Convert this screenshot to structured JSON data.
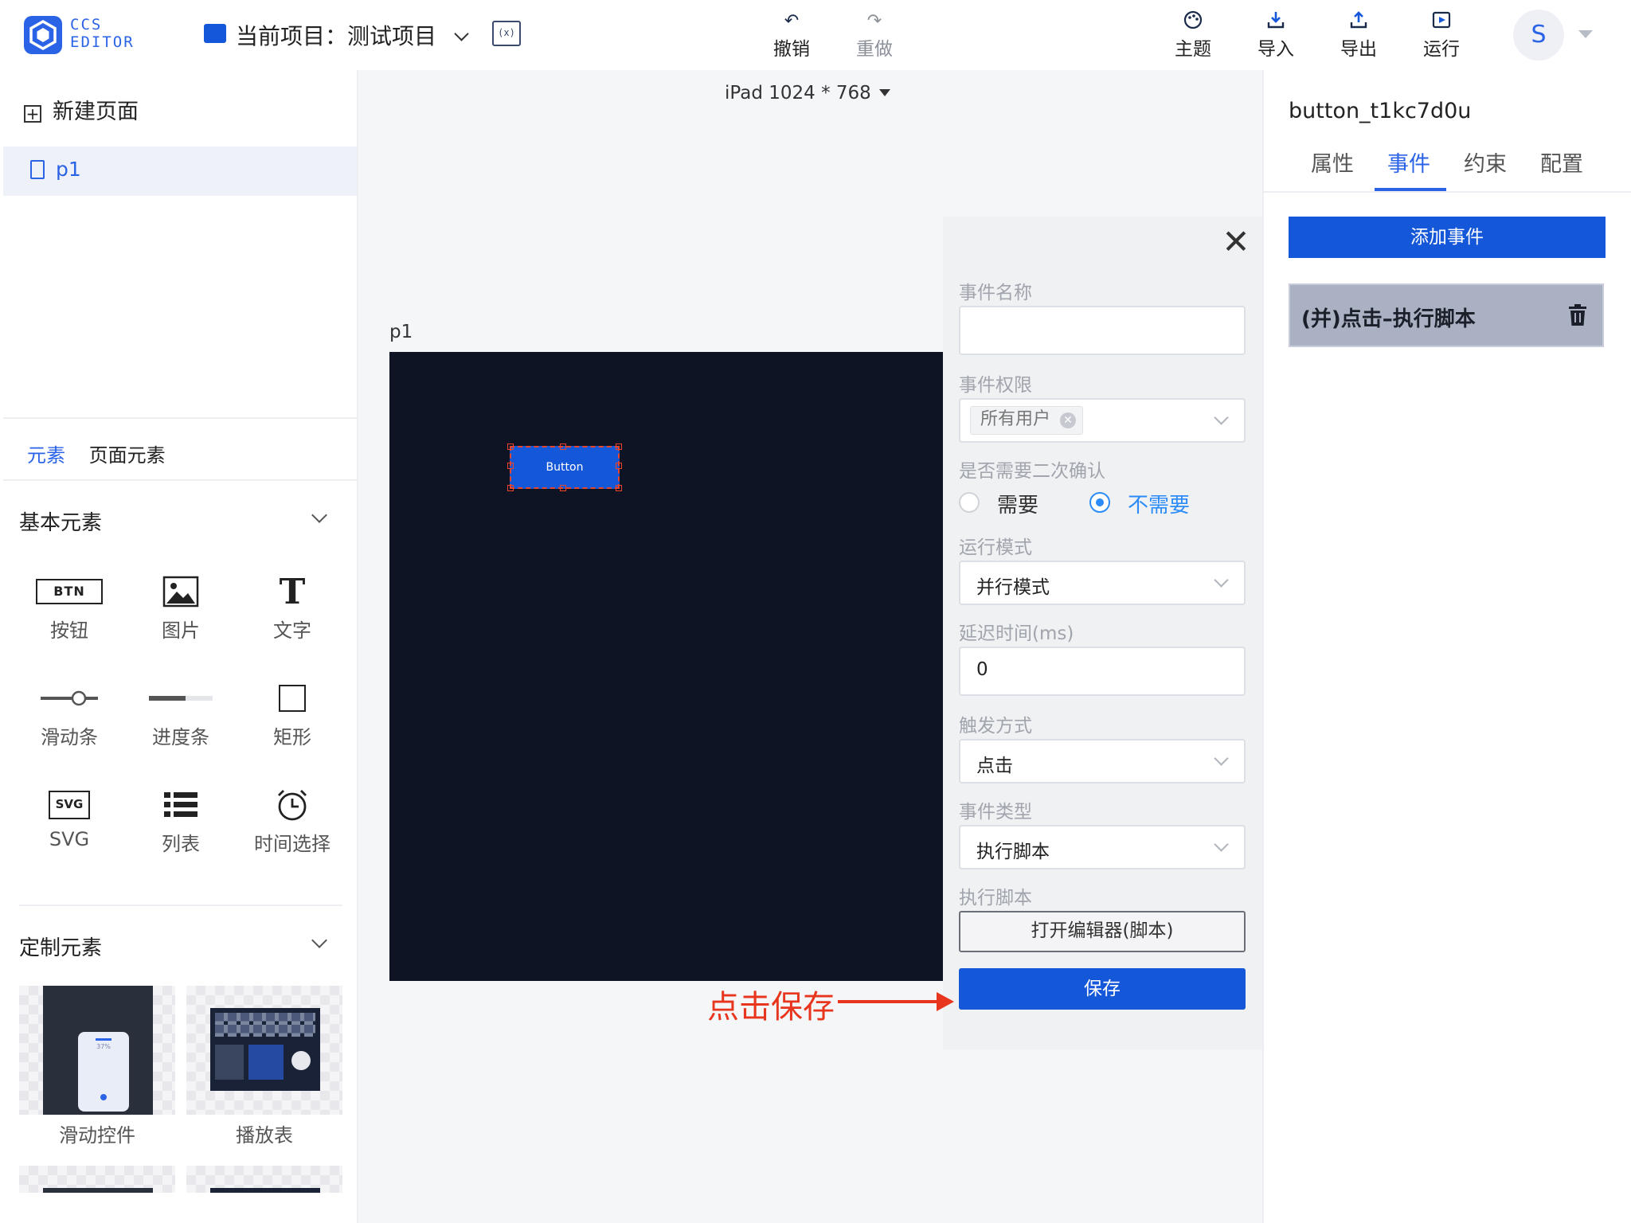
{
  "app": {
    "logo_text_line1": "CCS",
    "logo_text_line2": "EDITOR",
    "project_label": "当前项目：测试项目"
  },
  "toolbar": {
    "undo": "撤销",
    "redo": "重做",
    "theme": "主题",
    "import": "导入",
    "export": "导出",
    "run": "运行",
    "avatar_initial": "S"
  },
  "left_panel": {
    "new_page": "新建页面",
    "pages": [
      "p1"
    ],
    "tabs": [
      "元素",
      "页面元素"
    ],
    "basic_section": "基本元素",
    "basic_elements": [
      {
        "label": "按钮",
        "glyph": "BTN"
      },
      {
        "label": "图片",
        "glyph": "image-icon"
      },
      {
        "label": "文字",
        "glyph": "T"
      },
      {
        "label": "滑动条",
        "glyph": "slider-icon"
      },
      {
        "label": "进度条",
        "glyph": "progress-icon"
      },
      {
        "label": "矩形",
        "glyph": "rect-icon"
      },
      {
        "label": "SVG",
        "glyph": "SVG"
      },
      {
        "label": "列表",
        "glyph": "list-icon"
      },
      {
        "label": "时间选择",
        "glyph": "clock-icon"
      }
    ],
    "custom_section": "定制元素",
    "custom_elements": [
      {
        "label": "滑动控件",
        "thumb_text": "37%"
      },
      {
        "label": "播放表"
      }
    ]
  },
  "canvas": {
    "device": "iPad 1024 * 768",
    "page_name": "p1",
    "button_text": "Button",
    "canvas_bg": "#0f1425",
    "button_color": "#1557d9"
  },
  "event_dialog": {
    "event_name_label": "事件名称",
    "event_name_value": "",
    "permission_label": "事件权限",
    "permission_tag": "所有用户",
    "confirm_label": "是否需要二次确认",
    "confirm_options": [
      "需要",
      "不需要"
    ],
    "confirm_selected": "不需要",
    "run_mode_label": "运行模式",
    "run_mode_value": "并行模式",
    "delay_label": "延迟时间(ms)",
    "delay_value": "0",
    "trigger_label": "触发方式",
    "trigger_value": "点击",
    "event_type_label": "事件类型",
    "event_type_value": "执行脚本",
    "script_label": "执行脚本",
    "open_editor": "打开编辑器(脚本)",
    "save": "保存"
  },
  "annotation": {
    "text": "点击保存",
    "color": "#e8351e"
  },
  "right_panel": {
    "component_id": "button_t1kc7d0u",
    "tabs": [
      "属性",
      "事件",
      "约束",
      "配置"
    ],
    "active_tab": "事件",
    "add_event": "添加事件",
    "events": [
      "(并)点击–执行脚本"
    ]
  },
  "colors": {
    "primary": "#1557d9",
    "accent": "#2b63e7",
    "radio_blue": "#2b8cf7"
  }
}
